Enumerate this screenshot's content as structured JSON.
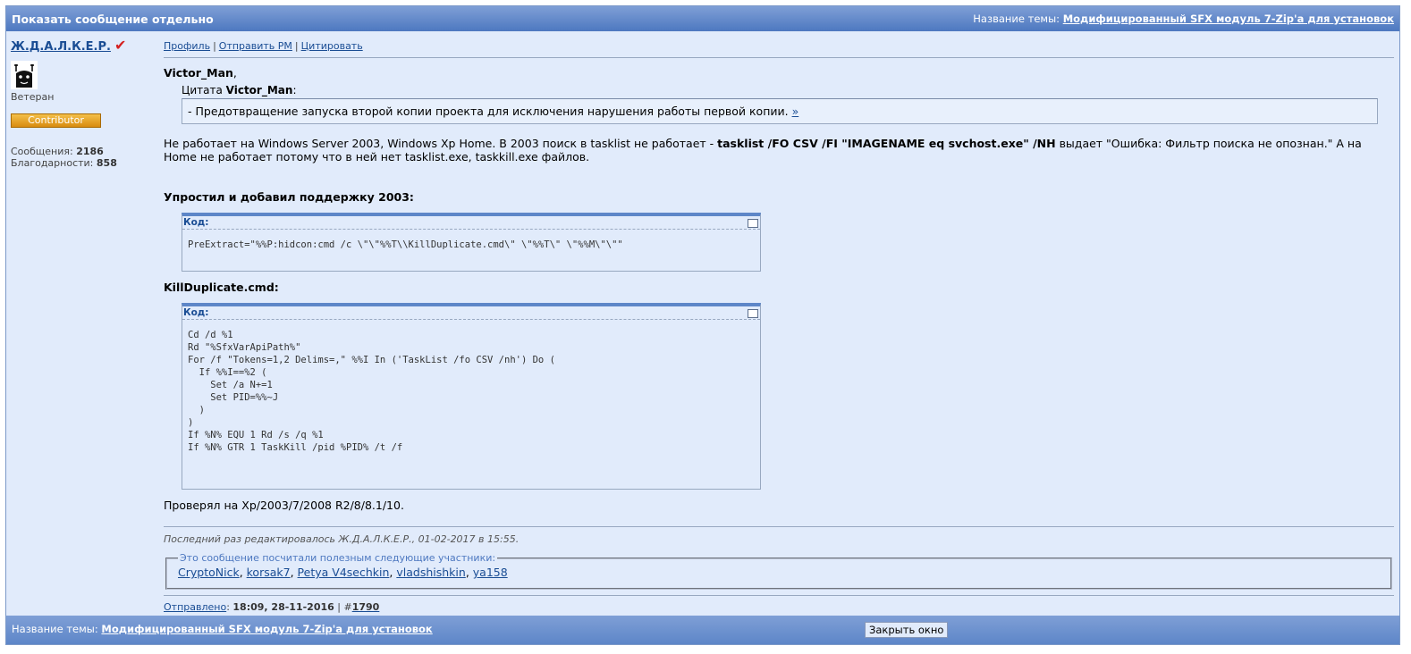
{
  "header": {
    "title": "Показать сообщение отдельно",
    "topic_label": "Название темы:",
    "topic_link": "Модифицированный SFX модуль 7-Zip'a для установок"
  },
  "author": {
    "username": "Ж.Д.А.Л.К.Е.Р.",
    "rank": "Ветеран",
    "badge": "Contributor",
    "messages_label": "Сообщения:",
    "messages": "2186",
    "thanks_label": "Благодарности:",
    "thanks": "858"
  },
  "post": {
    "links": {
      "profile": "Профиль",
      "pm": "Отправить PM",
      "quote": "Цитировать"
    },
    "greet_name": "Victor_Man",
    "quote": {
      "prefix": "Цитата",
      "author": "Victor_Man",
      "text": "- Предотвращение запуска второй копии проекта для исключения нарушения работы первой копии.",
      "link": "»"
    },
    "para1_a": "Не работает на Windows Server 2003, Windows Xp Home. В 2003 поиск в tasklist не работает - ",
    "para1_b": "tasklist /FO CSV /FI \"IMAGENAME eq svchost.exe\" /NH",
    "para1_c": " выдает \"Ошибка: Фильтр поиска не опознан.\" А на Home не работает потому что в ней нет tasklist.exe, taskkill.exe файлов.",
    "heading1": "Упростил и добавил поддержку 2003:",
    "code_title": "Код:",
    "code1": "PreExtract=\"%%P:hidcon:cmd /c \\\"\\\"%%T\\\\KillDuplicate.cmd\\\" \\\"%%T\\\" \\\"%%M\\\"\\\"\"",
    "heading2": "KillDuplicate.cmd:",
    "code2": "Cd /d %1\nRd \"%SfxVarApiPath%\"\nFor /f \"Tokens=1,2 Delims=,\" %%I In ('TaskList /fo CSV /nh') Do (\n  If %%I==%2 (\n    Set /a N+=1\n    Set PID=%%~J\n  )\n)\nIf %N% EQU 1 Rd /s /q %1\nIf %N% GTR 1 TaskKill /pid %PID% /t /f",
    "checked": "Проверял на Xp/2003/7/2008 R2/8/8.1/10.",
    "edited": "Последний раз редактировалось Ж.Д.А.Л.К.Е.Р., 01-02-2017 в 15:55.",
    "thanks_legend": "Это сообщение посчитали полезным следующие участники:",
    "thanked_users": [
      "CryptoNick",
      "korsak7",
      "Petya V4sechkin",
      "vladshishkin",
      "ya158"
    ],
    "sent_label": "Отправлено",
    "sent_time": "18:09, 28-11-2016",
    "post_num": "1790"
  },
  "footer": {
    "topic_label": "Название темы:",
    "topic_link": "Модифицированный SFX модуль 7-Zip'a для установок",
    "close_button": "Закрыть окно"
  },
  "colors": {
    "bar": "#5d86c8",
    "bg": "#e1ebfb",
    "link": "#1a4d94",
    "badge": "#e8a020"
  }
}
